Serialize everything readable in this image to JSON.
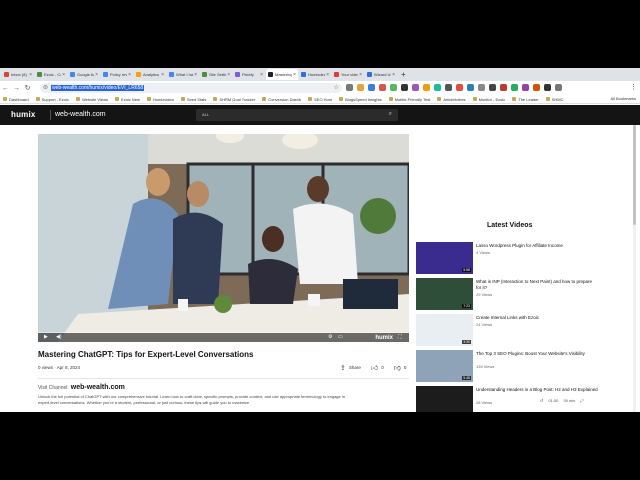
{
  "browser": {
    "tabs": [
      {
        "label": "Inbox (8)",
        "icon_color": "#d44638"
      },
      {
        "label": "Ezoic - Con",
        "icon_color": "#4a8f3a"
      },
      {
        "label": "Google Ad",
        "icon_color": "#4285f4"
      },
      {
        "label": "Policy revie",
        "icon_color": "#4285f4"
      },
      {
        "label": "Analytics",
        "icon_color": "#f4a300"
      },
      {
        "label": "What I had t",
        "icon_color": "#4285f4"
      },
      {
        "label": "Site Setting",
        "icon_color": "#4a8f3a"
      },
      {
        "label": "Pixlefy",
        "icon_color": "#7b5bd6"
      },
      {
        "label": "Mastering C",
        "icon_color": "#222222"
      },
      {
        "label": "Humixdean",
        "icon_color": "#2f6fd6"
      },
      {
        "label": "Your videos",
        "icon_color": "#e53935"
      },
      {
        "label": "Wizard Use",
        "icon_color": "#2f6fd6"
      }
    ],
    "active_tab": 8,
    "url": "web-wealth.com/humix/video/EVI_LR658",
    "bookmarks": [
      "Dashboard",
      "Support - Ezoic",
      "Website Views",
      "Ezoic New",
      "Humixvideo",
      "Seed Stats",
      "SHRM Goal Tracker",
      "Conversion Dashb",
      "SEO Hum",
      "BlogsSpeed Insights",
      "Mobile-Friendly Test",
      "Articleforbes",
      "Monitor - Ezoic",
      "The Leader",
      "SHMC"
    ],
    "all_bookmarks": "All Bookmarks"
  },
  "site": {
    "logo_text": "humix",
    "site_name": "web-wealth.com",
    "search_scope": "ALL"
  },
  "video": {
    "title": "Mastering ChatGPT: Tips for Expert-Level Conversations",
    "meta": "0 views · Apr 8, 2024",
    "share_label": "Share",
    "likes": "0",
    "dislikes": "0",
    "player_logo": "humix",
    "visit_label": "Visit Channel:",
    "channel": "web-wealth.com",
    "description_line1": "Unlock the full potential of ChatGPT with our comprehensive tutorial. Learn how to craft clear, specific prompts, provide context, and use appropriate terminology to engage in",
    "description_line2": "expert-level conversations. Whether you're a student, professional, or just curious, these tips will guide you to maximize"
  },
  "sidebar": {
    "heading": "Latest Videos",
    "items": [
      {
        "title": "Lasso Wordpress Plugin for Affiliate Income",
        "views": "4 Views",
        "duration": "5:58",
        "thumb": "#3a2b8f"
      },
      {
        "title": "What is INP (Interaction to Next Paint) and how to prepare for it?",
        "views": "29 Views",
        "duration": "7:23",
        "thumb": "#2f4e3a"
      },
      {
        "title": "Create Internal Links with Ezoic",
        "views": "24 Views",
        "duration": "3:30",
        "thumb": "#e9eef3"
      },
      {
        "title": "The Top 3 SEO Plugins: Boost Your Website's Visibility",
        "views": "139 Views",
        "duration": "5:48",
        "thumb": "#8fa3b8"
      },
      {
        "title": "Understanding Headers in a Blog Post: H2 and H3 Explained",
        "views": "28 Views",
        "duration": "3:54",
        "thumb": "#1c1c1c"
      }
    ]
  },
  "status": {
    "zoom": "01:50",
    "ratio": "39 min"
  }
}
